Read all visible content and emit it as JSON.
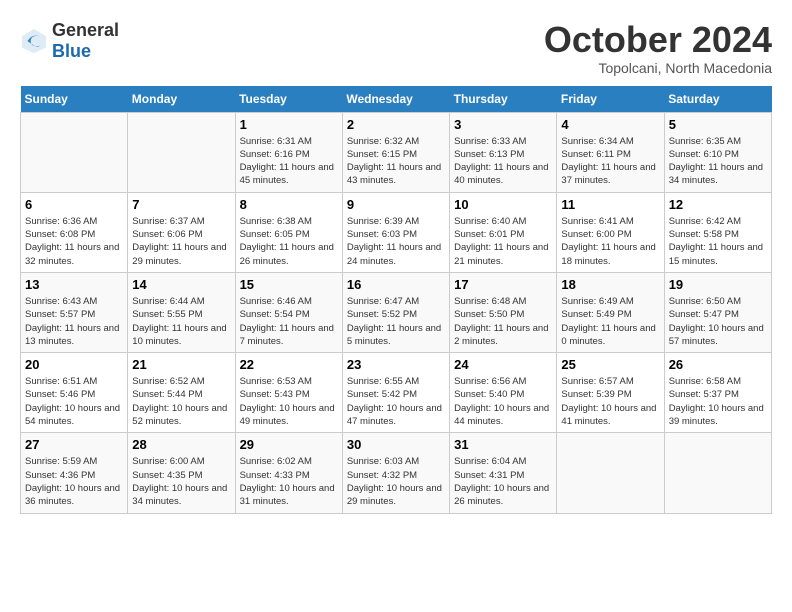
{
  "header": {
    "logo_general": "General",
    "logo_blue": "Blue",
    "month_title": "October 2024",
    "subtitle": "Topolcani, North Macedonia"
  },
  "days_of_week": [
    "Sunday",
    "Monday",
    "Tuesday",
    "Wednesday",
    "Thursday",
    "Friday",
    "Saturday"
  ],
  "weeks": [
    [
      {
        "day": "",
        "info": ""
      },
      {
        "day": "",
        "info": ""
      },
      {
        "day": "1",
        "info": "Sunrise: 6:31 AM\nSunset: 6:16 PM\nDaylight: 11 hours and 45 minutes."
      },
      {
        "day": "2",
        "info": "Sunrise: 6:32 AM\nSunset: 6:15 PM\nDaylight: 11 hours and 43 minutes."
      },
      {
        "day": "3",
        "info": "Sunrise: 6:33 AM\nSunset: 6:13 PM\nDaylight: 11 hours and 40 minutes."
      },
      {
        "day": "4",
        "info": "Sunrise: 6:34 AM\nSunset: 6:11 PM\nDaylight: 11 hours and 37 minutes."
      },
      {
        "day": "5",
        "info": "Sunrise: 6:35 AM\nSunset: 6:10 PM\nDaylight: 11 hours and 34 minutes."
      }
    ],
    [
      {
        "day": "6",
        "info": "Sunrise: 6:36 AM\nSunset: 6:08 PM\nDaylight: 11 hours and 32 minutes."
      },
      {
        "day": "7",
        "info": "Sunrise: 6:37 AM\nSunset: 6:06 PM\nDaylight: 11 hours and 29 minutes."
      },
      {
        "day": "8",
        "info": "Sunrise: 6:38 AM\nSunset: 6:05 PM\nDaylight: 11 hours and 26 minutes."
      },
      {
        "day": "9",
        "info": "Sunrise: 6:39 AM\nSunset: 6:03 PM\nDaylight: 11 hours and 24 minutes."
      },
      {
        "day": "10",
        "info": "Sunrise: 6:40 AM\nSunset: 6:01 PM\nDaylight: 11 hours and 21 minutes."
      },
      {
        "day": "11",
        "info": "Sunrise: 6:41 AM\nSunset: 6:00 PM\nDaylight: 11 hours and 18 minutes."
      },
      {
        "day": "12",
        "info": "Sunrise: 6:42 AM\nSunset: 5:58 PM\nDaylight: 11 hours and 15 minutes."
      }
    ],
    [
      {
        "day": "13",
        "info": "Sunrise: 6:43 AM\nSunset: 5:57 PM\nDaylight: 11 hours and 13 minutes."
      },
      {
        "day": "14",
        "info": "Sunrise: 6:44 AM\nSunset: 5:55 PM\nDaylight: 11 hours and 10 minutes."
      },
      {
        "day": "15",
        "info": "Sunrise: 6:46 AM\nSunset: 5:54 PM\nDaylight: 11 hours and 7 minutes."
      },
      {
        "day": "16",
        "info": "Sunrise: 6:47 AM\nSunset: 5:52 PM\nDaylight: 11 hours and 5 minutes."
      },
      {
        "day": "17",
        "info": "Sunrise: 6:48 AM\nSunset: 5:50 PM\nDaylight: 11 hours and 2 minutes."
      },
      {
        "day": "18",
        "info": "Sunrise: 6:49 AM\nSunset: 5:49 PM\nDaylight: 11 hours and 0 minutes."
      },
      {
        "day": "19",
        "info": "Sunrise: 6:50 AM\nSunset: 5:47 PM\nDaylight: 10 hours and 57 minutes."
      }
    ],
    [
      {
        "day": "20",
        "info": "Sunrise: 6:51 AM\nSunset: 5:46 PM\nDaylight: 10 hours and 54 minutes."
      },
      {
        "day": "21",
        "info": "Sunrise: 6:52 AM\nSunset: 5:44 PM\nDaylight: 10 hours and 52 minutes."
      },
      {
        "day": "22",
        "info": "Sunrise: 6:53 AM\nSunset: 5:43 PM\nDaylight: 10 hours and 49 minutes."
      },
      {
        "day": "23",
        "info": "Sunrise: 6:55 AM\nSunset: 5:42 PM\nDaylight: 10 hours and 47 minutes."
      },
      {
        "day": "24",
        "info": "Sunrise: 6:56 AM\nSunset: 5:40 PM\nDaylight: 10 hours and 44 minutes."
      },
      {
        "day": "25",
        "info": "Sunrise: 6:57 AM\nSunset: 5:39 PM\nDaylight: 10 hours and 41 minutes."
      },
      {
        "day": "26",
        "info": "Sunrise: 6:58 AM\nSunset: 5:37 PM\nDaylight: 10 hours and 39 minutes."
      }
    ],
    [
      {
        "day": "27",
        "info": "Sunrise: 5:59 AM\nSunset: 4:36 PM\nDaylight: 10 hours and 36 minutes."
      },
      {
        "day": "28",
        "info": "Sunrise: 6:00 AM\nSunset: 4:35 PM\nDaylight: 10 hours and 34 minutes."
      },
      {
        "day": "29",
        "info": "Sunrise: 6:02 AM\nSunset: 4:33 PM\nDaylight: 10 hours and 31 minutes."
      },
      {
        "day": "30",
        "info": "Sunrise: 6:03 AM\nSunset: 4:32 PM\nDaylight: 10 hours and 29 minutes."
      },
      {
        "day": "31",
        "info": "Sunrise: 6:04 AM\nSunset: 4:31 PM\nDaylight: 10 hours and 26 minutes."
      },
      {
        "day": "",
        "info": ""
      },
      {
        "day": "",
        "info": ""
      }
    ]
  ]
}
